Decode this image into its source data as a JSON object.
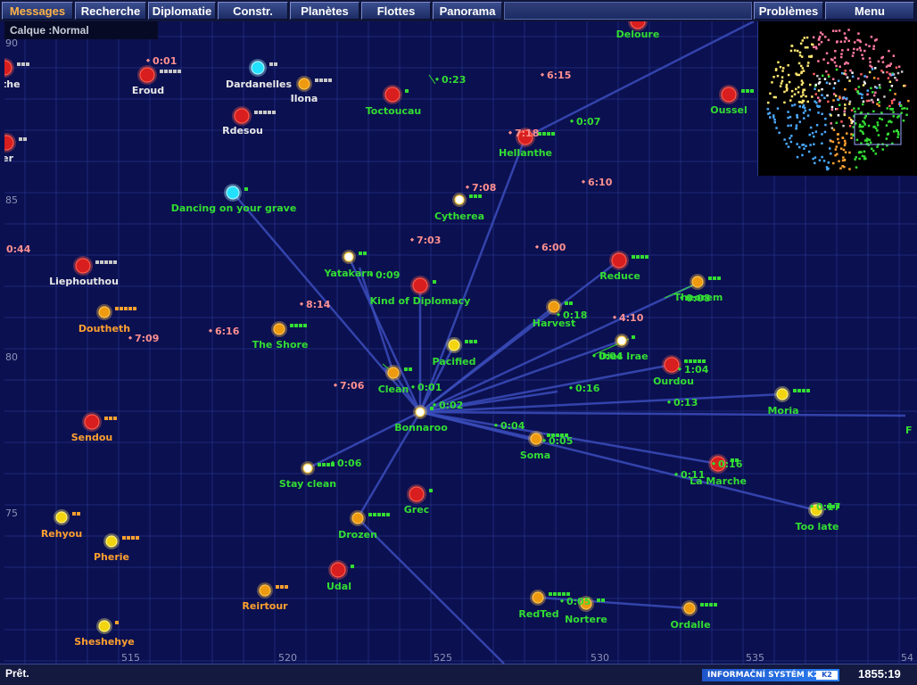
{
  "toolbar": {
    "buttons": [
      {
        "label": "Messages",
        "active": true
      },
      {
        "label": "Recherche"
      },
      {
        "label": "Diplomatie"
      },
      {
        "label": "Constr."
      },
      {
        "label": "Planètes"
      },
      {
        "label": "Flottes"
      },
      {
        "label": "Panorama"
      },
      {
        "label": "Problèmes"
      },
      {
        "label": "Menu"
      }
    ]
  },
  "layer_label": "Calque :Normal",
  "axis": {
    "left": [
      "90",
      "85",
      "80",
      "75"
    ],
    "bottom": [
      "515",
      "520",
      "525",
      "530",
      "535",
      "54"
    ]
  },
  "planets": [
    {
      "name": "Deloure",
      "color": "#33dd33",
      "kind": "red"
    },
    {
      "name": "yethe",
      "color": "#e8e8e8",
      "kind": "red"
    },
    {
      "name": "Eroud",
      "color": "#e8e8e8",
      "kind": "red"
    },
    {
      "name": "Dardanelles",
      "color": "#e8e8e8",
      "kind": "cyan"
    },
    {
      "name": "Ilona",
      "color": "#e8e8e8",
      "kind": "orange"
    },
    {
      "name": "Toctoucau",
      "color": "#33dd33",
      "kind": "red"
    },
    {
      "name": "Oussel",
      "color": "#33dd33",
      "kind": "red"
    },
    {
      "name": "Rdesou",
      "color": "#e8e8e8",
      "kind": "red"
    },
    {
      "name": "yer",
      "color": "#e8e8e8",
      "kind": "red"
    },
    {
      "name": "Hellanthe",
      "color": "#33dd33",
      "kind": "red"
    },
    {
      "name": "Dancing on your grave",
      "color": "#33dd33",
      "kind": "cyan"
    },
    {
      "name": "Cytherea",
      "color": "#33dd33",
      "kind": "white"
    },
    {
      "name": "Liephouthou",
      "color": "#e8e8e8",
      "kind": "red"
    },
    {
      "name": "Yatakarn",
      "color": "#33dd33",
      "kind": "white"
    },
    {
      "name": "Reduce",
      "color": "#33dd33",
      "kind": "red"
    },
    {
      "name": "Kind of Diplomacy",
      "color": "#33dd33",
      "kind": "red"
    },
    {
      "name": "Theorem",
      "color": "#33dd33",
      "kind": "orange"
    },
    {
      "name": "Doutheth",
      "color": "#ffa030",
      "kind": "orange"
    },
    {
      "name": "Harvest",
      "color": "#33dd33",
      "kind": "orange"
    },
    {
      "name": "The Shore",
      "color": "#33dd33",
      "kind": "orange"
    },
    {
      "name": "Dies Irae",
      "color": "#33dd33",
      "kind": "white"
    },
    {
      "name": "Pacified",
      "color": "#33dd33",
      "kind": "yellow"
    },
    {
      "name": "Ourdou",
      "color": "#33dd33",
      "kind": "red"
    },
    {
      "name": "Clean",
      "color": "#33dd33",
      "kind": "orange"
    },
    {
      "name": "Moria",
      "color": "#33dd33",
      "kind": "yellow"
    },
    {
      "name": "Bonnaroo",
      "color": "#33dd33",
      "kind": "white"
    },
    {
      "name": "Sendou",
      "color": "#ffa030",
      "kind": "red"
    },
    {
      "name": "Soma",
      "color": "#33dd33",
      "kind": "orange"
    },
    {
      "name": "La Marche",
      "color": "#33dd33",
      "kind": "red"
    },
    {
      "name": "Stay clean",
      "color": "#33dd33",
      "kind": "white"
    },
    {
      "name": "Grec",
      "color": "#33dd33",
      "kind": "red"
    },
    {
      "name": "Too late",
      "color": "#33dd33",
      "kind": "yellow"
    },
    {
      "name": "Drozen",
      "color": "#33dd33",
      "kind": "orange"
    },
    {
      "name": "Rehyou",
      "color": "#ffa030",
      "kind": "yellow"
    },
    {
      "name": "Pherie",
      "color": "#ffa030",
      "kind": "yellow"
    },
    {
      "name": "Udal",
      "color": "#33dd33",
      "kind": "red"
    },
    {
      "name": "Reirtour",
      "color": "#ffa030",
      "kind": "orange"
    },
    {
      "name": "RedTed",
      "color": "#33dd33",
      "kind": "orange"
    },
    {
      "name": "Nortere",
      "color": "#33dd33",
      "kind": "orange"
    },
    {
      "name": "Ordalle",
      "color": "#33dd33",
      "kind": "orange"
    },
    {
      "name": "Sheshehye",
      "color": "#ffa030",
      "kind": "yellow"
    }
  ],
  "etas": [
    {
      "text": "0:01",
      "color": "#ff9090"
    },
    {
      "text": "0:23",
      "color": "#33dd33"
    },
    {
      "text": "6:15",
      "color": "#ff9090"
    },
    {
      "text": "0:07",
      "color": "#33dd33"
    },
    {
      "text": "7:18",
      "color": "#ff9090"
    },
    {
      "text": "7:08",
      "color": "#ff9090"
    },
    {
      "text": "6:10",
      "color": "#ff9090"
    },
    {
      "text": "0:44",
      "color": "#ff9090"
    },
    {
      "text": "7:03",
      "color": "#ff9090"
    },
    {
      "text": "6:00",
      "color": "#ff9090"
    },
    {
      "text": "0:09",
      "color": "#33dd33"
    },
    {
      "text": "8:14",
      "color": "#ff9090"
    },
    {
      "text": "0:08",
      "color": "#33dd33"
    },
    {
      "text": "0:18",
      "color": "#33dd33"
    },
    {
      "text": "4:10",
      "color": "#ff9090"
    },
    {
      "text": "6:16",
      "color": "#ff9090"
    },
    {
      "text": "7:09",
      "color": "#ff9090"
    },
    {
      "text": "0:04",
      "color": "#33dd33"
    },
    {
      "text": "1:04",
      "color": "#33dd33"
    },
    {
      "text": "7:06",
      "color": "#ff9090"
    },
    {
      "text": "0:01",
      "color": "#33dd33"
    },
    {
      "text": "0:16",
      "color": "#33dd33"
    },
    {
      "text": "0:02",
      "color": "#33dd33"
    },
    {
      "text": "0:13",
      "color": "#33dd33"
    },
    {
      "text": "0:04",
      "color": "#33dd33"
    },
    {
      "text": "0:05",
      "color": "#33dd33"
    },
    {
      "text": "0:06",
      "color": "#33dd33"
    },
    {
      "text": "0:16",
      "color": "#33dd33"
    },
    {
      "text": "0:11",
      "color": "#33dd33"
    },
    {
      "text": "0:17",
      "color": "#33dd33"
    },
    {
      "text": "0:05",
      "color": "#33dd33"
    }
  ],
  "edge_label": "F",
  "status": {
    "text": "Prêt.",
    "brand": "INFORMAČNÍ SYSTÉM K2",
    "brand_logo": "K2",
    "clock": "1855:19"
  },
  "colors": {
    "background": "#0b1050",
    "grid": "#2a3d9a",
    "fleet_line": "#3a4dbb",
    "friendly": "#33dd33",
    "neutral": "#e8e8e8",
    "ally": "#ffa030",
    "enemy_eta": "#ff9090"
  }
}
